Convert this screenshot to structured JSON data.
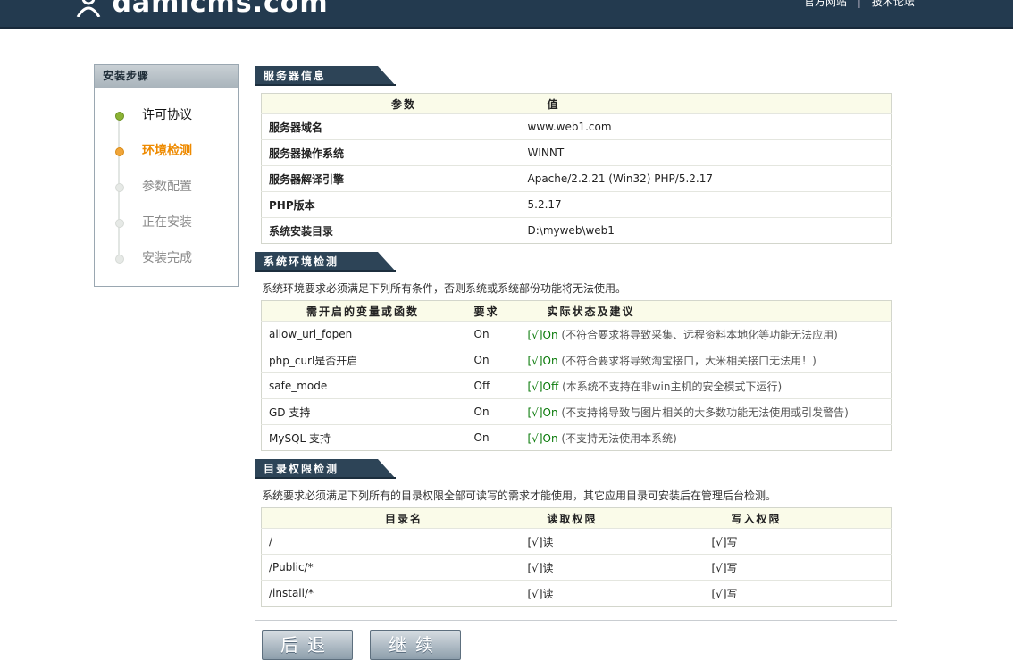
{
  "header": {
    "logo_text": "damicms.com",
    "links": [
      "官方网站",
      "技术论坛"
    ],
    "separator": "|"
  },
  "sidebar": {
    "title": "安装步骤",
    "steps": [
      {
        "label": "许可协议",
        "state": "done"
      },
      {
        "label": "环境检测",
        "state": "current"
      },
      {
        "label": "参数配置",
        "state": "todo"
      },
      {
        "label": "正在安装",
        "state": "todo"
      },
      {
        "label": "安装完成",
        "state": "todo"
      }
    ]
  },
  "server_info": {
    "title": "服务器信息",
    "columns": [
      "参数",
      "值"
    ],
    "rows": [
      [
        "服务器域名",
        "www.web1.com"
      ],
      [
        "服务器操作系统",
        "WINNT"
      ],
      [
        "服务器解译引擎",
        "Apache/2.2.21 (Win32) PHP/5.2.17"
      ],
      [
        "PHP版本",
        "5.2.17"
      ],
      [
        "系统安装目录",
        "D:\\myweb\\web1"
      ]
    ]
  },
  "env_check": {
    "title": "系统环境检测",
    "note": "系统环境要求必须满足下列所有条件，否则系统或系统部份功能将无法使用。",
    "columns": [
      "需开启的变量或函数",
      "要求",
      "实际状态及建议"
    ],
    "rows": [
      {
        "name": "allow_url_fopen",
        "req": "On",
        "status": "[√]On",
        "hint": "(不符合要求将导致采集、远程资料本地化等功能无法应用)"
      },
      {
        "name": "php_curl是否开启",
        "req": "On",
        "status": "[√]On",
        "hint": "(不符合要求将导致淘宝接口，大米相关接口无法用！)"
      },
      {
        "name": "safe_mode",
        "req": "Off",
        "status": "[√]Off",
        "hint": "(本系统不支持在非win主机的安全模式下运行)"
      },
      {
        "name": "GD 支持",
        "req": "On",
        "status": "[√]On",
        "hint": "(不支持将导致与图片相关的大多数功能无法使用或引发警告)"
      },
      {
        "name": "MySQL 支持",
        "req": "On",
        "status": "[√]On",
        "hint": "(不支持无法使用本系统)"
      }
    ]
  },
  "dir_check": {
    "title": "目录权限检测",
    "note": "系统要求必须满足下列所有的目录权限全部可读写的需求才能使用，其它应用目录可安装后在管理后台检测。",
    "columns": [
      "目录名",
      "读取权限",
      "写入权限"
    ],
    "rows": [
      [
        "/",
        "[√]读",
        "[√]写"
      ],
      [
        "/Public/*",
        "[√]读",
        "[√]写"
      ],
      [
        "/install/*",
        "[√]读",
        "[√]写"
      ]
    ]
  },
  "buttons": {
    "back": "后退",
    "next": "继续"
  },
  "colors": {
    "header_bg": "#233a4f",
    "current_step": "#ee8a00",
    "ok_green": "#0a7a0a",
    "table_head_bg": "#fafbe9"
  }
}
